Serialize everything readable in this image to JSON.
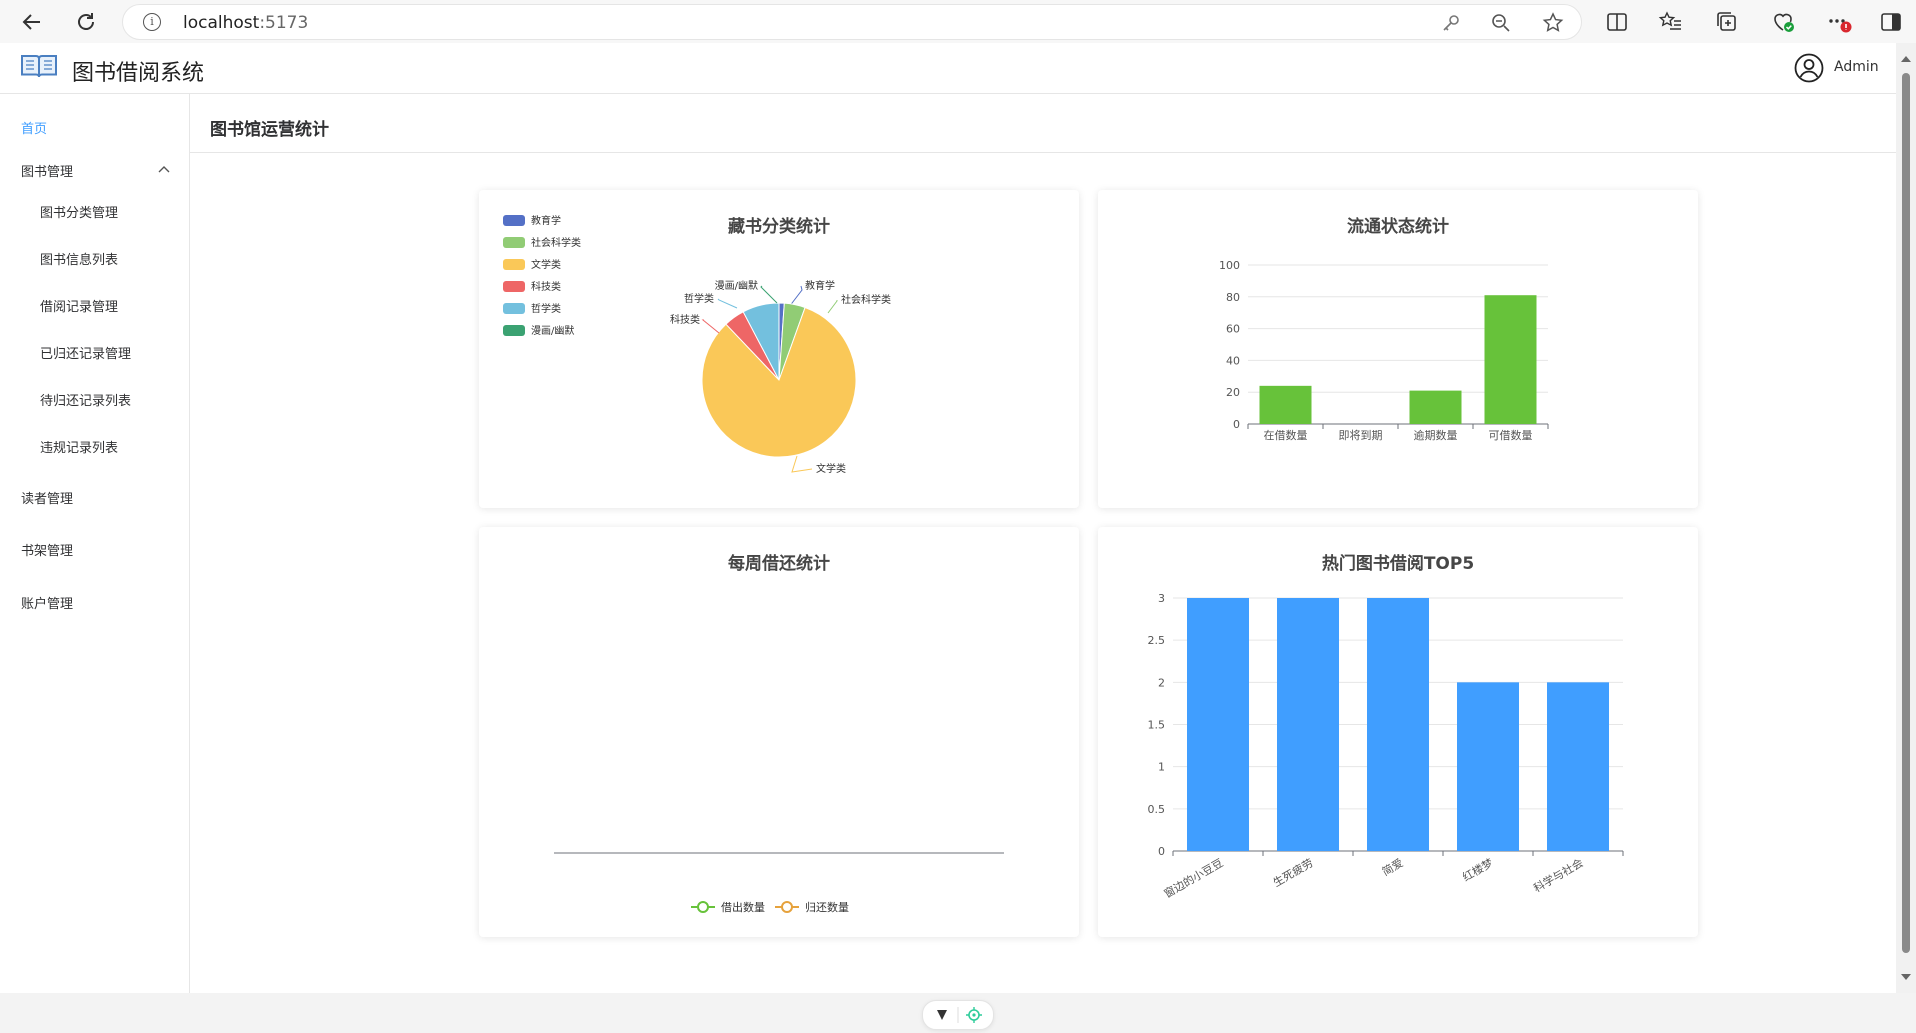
{
  "browser": {
    "url_host": "localhost",
    "url_port": ":5173"
  },
  "header": {
    "app_title": "图书借阅系统",
    "user_name": "Admin"
  },
  "sidebar": {
    "home": "首页",
    "book_management": "图书管理",
    "book_sub": [
      "图书分类管理",
      "图书信息列表",
      "借阅记录管理",
      "已归还记录管理",
      "待归还记录列表",
      "违规记录列表"
    ],
    "reader_management": "读者管理",
    "shelf_management": "书架管理",
    "account_management": "账户管理"
  },
  "main": {
    "title": "图书馆运营统计"
  },
  "colors": {
    "accent": "#409eff",
    "bar_green": "#67c23a",
    "bar_blue": "#409eff"
  },
  "chart_data": [
    {
      "type": "pie",
      "title": "藏书分类统计",
      "legend_position": "top-left",
      "categories": [
        "教育学",
        "社会科学类",
        "文学类",
        "科技类",
        "哲学类",
        "漫画/幽默"
      ],
      "values": [
        1,
        4,
        75,
        4,
        7,
        0
      ],
      "colors": [
        "#5470c6",
        "#91cc75",
        "#fac858",
        "#ee6666",
        "#73c0de",
        "#3ba272"
      ]
    },
    {
      "type": "bar",
      "title": "流通状态统计",
      "categories": [
        "在借数量",
        "即将到期",
        "逾期数量",
        "可借数量"
      ],
      "values": [
        24,
        0,
        21,
        81
      ],
      "ylim": [
        0,
        100
      ],
      "yticks": [
        "0",
        "20",
        "40",
        "60",
        "80",
        "100"
      ]
    },
    {
      "type": "line",
      "title": "每周借还统计",
      "series": [
        {
          "name": "借出数量",
          "values": []
        },
        {
          "name": "归还数量",
          "values": []
        }
      ],
      "colors": [
        "#67c23a",
        "#e6a23c"
      ]
    },
    {
      "type": "bar",
      "title": "热门图书借阅TOP5",
      "categories": [
        "窗边的小豆豆",
        "生死疲劳",
        "简爱",
        "红楼梦",
        "科学与社会"
      ],
      "values": [
        3,
        3,
        3,
        2,
        2
      ],
      "ylim": [
        0,
        3
      ],
      "yticks": [
        "0",
        "0.5",
        "1",
        "1.5",
        "2",
        "2.5",
        "3"
      ]
    }
  ]
}
